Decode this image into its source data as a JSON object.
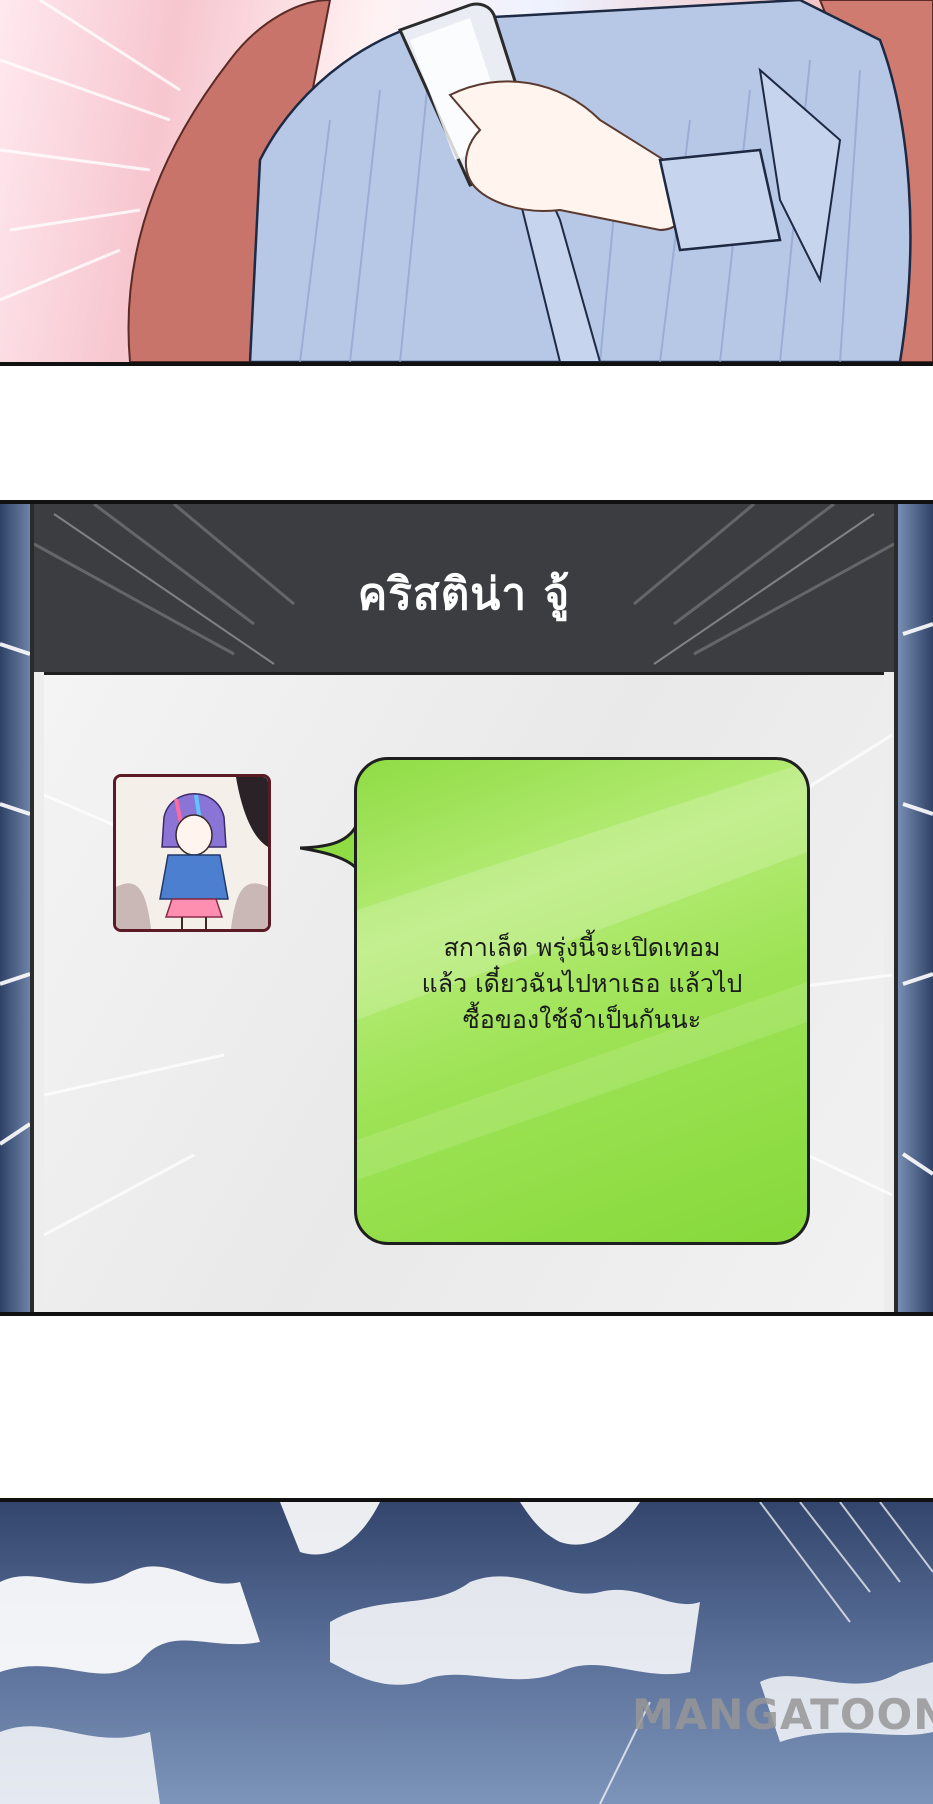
{
  "chat": {
    "contact_name": "คริสติน่า จู้",
    "message_lines": [
      "สกาเล็ต พรุ่งนี้จะเปิดเทอม",
      "แล้ว เดี๋ยวฉันไปหาเธอ แล้วไป",
      "ซื้อของใช้จำเป็นกันนะ"
    ]
  },
  "watermark": "MANGATOON",
  "colors": {
    "bubble": "#9ee356",
    "header": "#3c3d41",
    "panel_border": "#111111"
  },
  "icons": {
    "avatar": "avatar-illustration"
  }
}
